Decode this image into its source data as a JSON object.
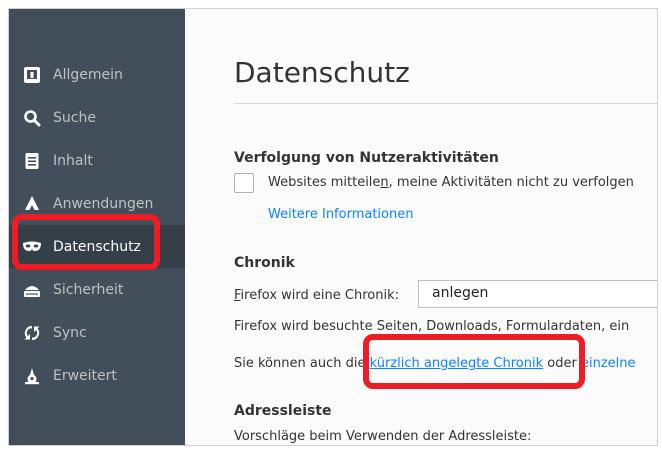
{
  "sidebar": {
    "items": [
      {
        "label": "Allgemein",
        "icon": "general-icon"
      },
      {
        "label": "Suche",
        "icon": "search-icon"
      },
      {
        "label": "Inhalt",
        "icon": "content-icon"
      },
      {
        "label": "Anwendungen",
        "icon": "applications-icon"
      },
      {
        "label": "Datenschutz",
        "icon": "privacy-mask-icon",
        "selected": true
      },
      {
        "label": "Sicherheit",
        "icon": "security-icon"
      },
      {
        "label": "Sync",
        "icon": "sync-icon"
      },
      {
        "label": "Erweitert",
        "icon": "advanced-icon"
      }
    ]
  },
  "main": {
    "title": "Datenschutz",
    "tracking": {
      "heading": "Verfolgung von Nutzeraktivitäten",
      "checkbox_label_pre": "Websites mitteile",
      "checkbox_label_access": "n",
      "checkbox_label_post": ", meine Aktivitäten nicht zu verfolgen",
      "checked": false,
      "more_info": "Weitere Informationen"
    },
    "history": {
      "heading": "Chronik",
      "label_access": "F",
      "label_rest": "irefox wird eine Chronik:",
      "select_value": "anlegen",
      "description": "Firefox wird besuchte Seiten, Downloads, Formulardaten, ein",
      "clear_pre": "Sie können auch die ",
      "clear_link": "kürzlich angelegte Chronik",
      "clear_mid": " oder ",
      "clear_link2": "einzelne"
    },
    "addressbar": {
      "heading": "Adressleiste",
      "suggestions_label": "Vorschläge beim Verwenden der Adressleiste:"
    }
  },
  "colors": {
    "sidebar_bg": "#424f5a",
    "sidebar_selected_bg": "#343f48",
    "link": "#0a84ff",
    "highlight": "#ee1c25"
  }
}
